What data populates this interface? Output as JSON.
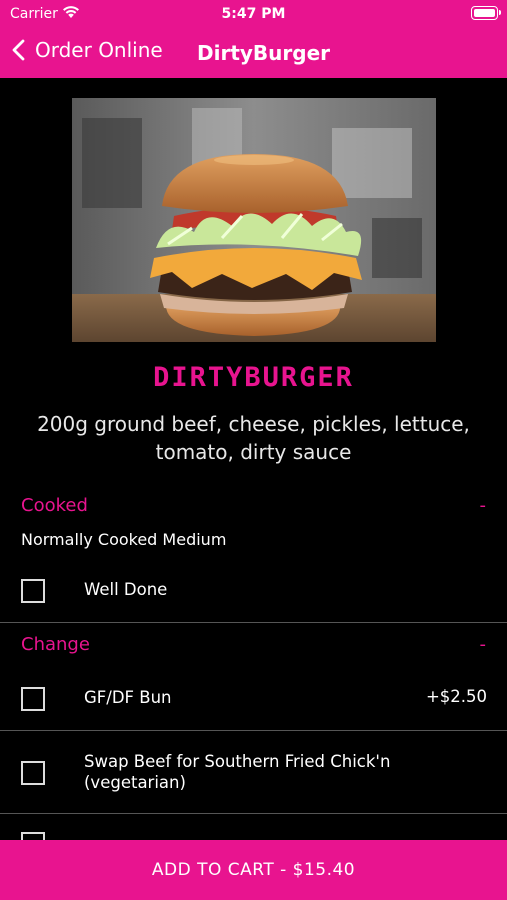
{
  "status_bar": {
    "carrier": "Carrier",
    "time": "5:47 PM"
  },
  "nav": {
    "back_label": "Order Online",
    "title": "DirtyBurger"
  },
  "product": {
    "name": "DIRTYBURGER",
    "description": "200g ground beef, cheese, pickles, lettuce, tomato, dirty sauce"
  },
  "sections": [
    {
      "title": "Cooked",
      "collapse": "-",
      "subtitle": "Normally Cooked Medium",
      "options": [
        {
          "label": "Well Done",
          "price": ""
        }
      ]
    },
    {
      "title": "Change",
      "collapse": "-",
      "options": [
        {
          "label": "GF/DF Bun",
          "price": "+$2.50"
        },
        {
          "label": "Swap Beef for Southern Fried Chick'n (vegetarian)",
          "price": ""
        }
      ]
    }
  ],
  "cart_button": "ADD TO CART - $15.40",
  "colors": {
    "accent": "#e8148f",
    "background": "#000000"
  }
}
